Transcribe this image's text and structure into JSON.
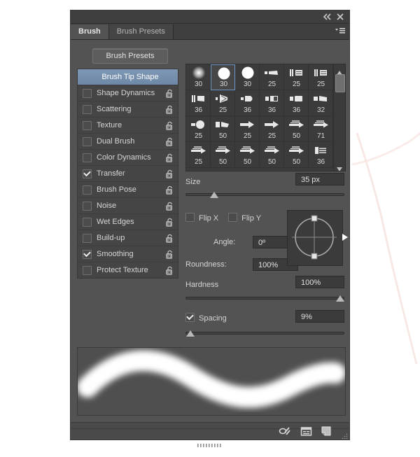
{
  "window": {
    "collapse_icon": "double-chevron-left-icon",
    "close_icon": "close-icon",
    "panel_menu_icon": "panel-menu-icon"
  },
  "tabs": [
    {
      "label": "Brush",
      "active": true
    },
    {
      "label": "Brush Presets",
      "active": false
    }
  ],
  "presets_button": {
    "label": "Brush Presets"
  },
  "options": [
    {
      "label": "Brush Tip Shape",
      "type": "header",
      "selected": true
    },
    {
      "label": "Shape Dynamics",
      "checked": false,
      "lock": "lock-open-icon"
    },
    {
      "label": "Scattering",
      "checked": false,
      "lock": "lock-open-icon"
    },
    {
      "label": "Texture",
      "checked": false,
      "lock": "lock-open-icon"
    },
    {
      "label": "Dual Brush",
      "checked": false,
      "lock": "lock-open-icon"
    },
    {
      "label": "Color Dynamics",
      "checked": false,
      "lock": "lock-open-icon"
    },
    {
      "label": "Transfer",
      "checked": true,
      "lock": "lock-open-icon"
    },
    {
      "label": "Brush Pose",
      "checked": false,
      "lock": "lock-open-icon"
    },
    {
      "label": "Noise",
      "checked": false,
      "lock": "lock-open-icon"
    },
    {
      "label": "Wet Edges",
      "checked": false,
      "lock": "lock-open-icon"
    },
    {
      "label": "Build-up",
      "checked": false,
      "lock": "lock-open-icon"
    },
    {
      "label": "Smoothing",
      "checked": true,
      "lock": "lock-open-icon"
    },
    {
      "label": "Protect Texture",
      "checked": false,
      "lock": "lock-open-icon"
    }
  ],
  "brush_grid": {
    "selected_index": 1,
    "scroll_up_icon": "triangle-up-icon",
    "scroll_down_icon": "triangle-down-icon",
    "cells": [
      {
        "size": "30",
        "tip": "soft-round"
      },
      {
        "size": "30",
        "tip": "hard-round"
      },
      {
        "size": "30",
        "tip": "hard-round"
      },
      {
        "size": "25",
        "tip": "flat-angled"
      },
      {
        "size": "25",
        "tip": "bristle-flat"
      },
      {
        "size": "25",
        "tip": "bristle-flat"
      },
      {
        "size": "36",
        "tip": "bristle-wedge"
      },
      {
        "size": "25",
        "tip": "bristle-fan"
      },
      {
        "size": "36",
        "tip": "round-point"
      },
      {
        "size": "36",
        "tip": "flat-square"
      },
      {
        "size": "36",
        "tip": "flat-blunt"
      },
      {
        "size": "32",
        "tip": "flat-wedge"
      },
      {
        "size": "25",
        "tip": "round-blunt"
      },
      {
        "size": "50",
        "tip": "angle-wedge"
      },
      {
        "size": "25",
        "tip": "flat-arrow"
      },
      {
        "size": "25",
        "tip": "flat-arrow"
      },
      {
        "size": "50",
        "tip": "thin-arrow"
      },
      {
        "size": "71",
        "tip": "thin-arrow"
      },
      {
        "size": "25",
        "tip": "thin-arrow"
      },
      {
        "size": "50",
        "tip": "thin-arrow"
      },
      {
        "size": "50",
        "tip": "thin-arrow"
      },
      {
        "size": "50",
        "tip": "thin-arrow"
      },
      {
        "size": "50",
        "tip": "thin-arrow"
      },
      {
        "size": "36",
        "tip": "flat-block"
      }
    ]
  },
  "controls": {
    "size": {
      "label": "Size",
      "value": "35 px",
      "slider_percent": 18
    },
    "flip_x": {
      "label": "Flip X",
      "checked": false
    },
    "flip_y": {
      "label": "Flip Y",
      "checked": false
    },
    "angle": {
      "label": "Angle:",
      "value": "0º"
    },
    "roundness": {
      "label": "Roundness:",
      "value": "100%"
    },
    "hardness": {
      "label": "Hardness",
      "value": "100%",
      "slider_percent": 100
    },
    "spacing": {
      "label": "Spacing",
      "value": "9%",
      "checked": true,
      "slider_percent": 3
    }
  },
  "preview": {
    "name": "brush-stroke-preview"
  },
  "footer": {
    "buttons": [
      {
        "name": "toggle-brush-options-icon"
      },
      {
        "name": "new-preset-panel-icon"
      },
      {
        "name": "create-new-brush-icon"
      }
    ],
    "resize_grip_icon": "resize-grip-icon",
    "drag_handle_icon": "drag-handle-icon"
  },
  "colors": {
    "panel_bg": "#535353",
    "panel_dark": "#3f3f3f",
    "selected_blue": "#7e97b4",
    "text": "#d6d6d6",
    "accent_border": "#6f95c4"
  }
}
